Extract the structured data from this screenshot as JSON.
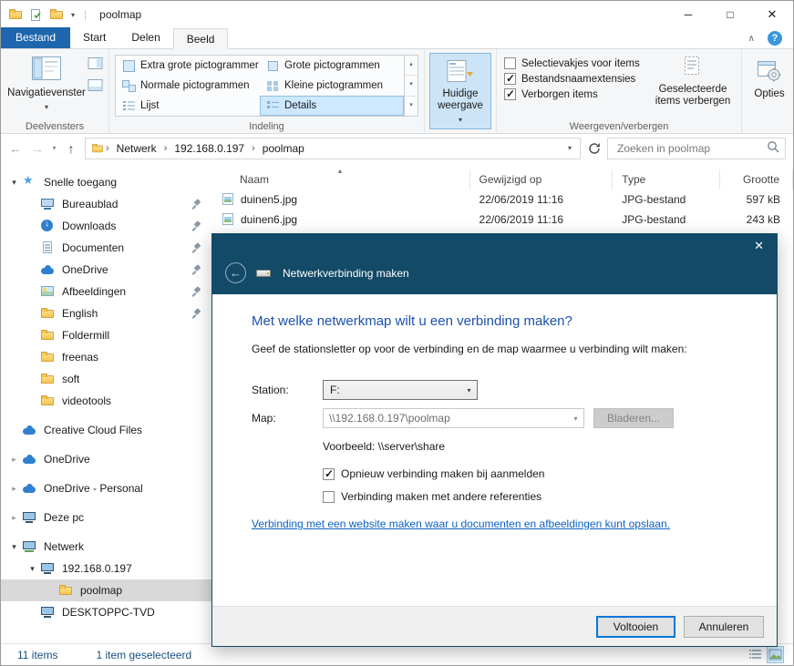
{
  "window": {
    "title": "poolmap"
  },
  "glyphs": {
    "minimize": "─",
    "maximize": "□",
    "close": "✕",
    "back": "←",
    "forward": "→",
    "up": "↑",
    "dropdown": "▾",
    "dropup": "▴",
    "crumb_separator": "›",
    "ribbon_collapse": "∧",
    "help": "?",
    "sort_ascending": "▴",
    "pipe": "|"
  },
  "icons": {
    "expand_open": "▾",
    "expand_closed": "▸",
    "checkbox_check": "✓",
    "quick_access_star": "★",
    "download_arrow": "↓"
  },
  "ribbon": {
    "tabs": [
      {
        "label": "Bestand",
        "style": "file"
      },
      {
        "label": "Start"
      },
      {
        "label": "Delen"
      },
      {
        "label": "Beeld",
        "active": true
      }
    ],
    "panes": {
      "group_label": "Deelvensters",
      "nav_button_label": "Navigatievenster"
    },
    "layout": {
      "group_label": "Indeling",
      "options": [
        {
          "label": "Extra grote pictogrammen"
        },
        {
          "label": "Grote pictogrammen"
        },
        {
          "label": "Normale pictogrammen"
        },
        {
          "label": "Kleine pictogrammen"
        },
        {
          "label": "Lijst"
        },
        {
          "label": "Details",
          "selected": true
        }
      ]
    },
    "current_view": {
      "button_label": "Huidige weergave"
    },
    "show_hide": {
      "group_label": "Weergeven/verbergen",
      "checkboxes": [
        {
          "label": "Selectievakjes voor items",
          "checked": false
        },
        {
          "label": "Bestandsnaamextensies",
          "checked": true
        },
        {
          "label": "Verborgen items",
          "checked": true
        }
      ],
      "hide_button_label": "Geselecteerde items verbergen"
    },
    "options": {
      "button_label": "Opties"
    }
  },
  "addressbar": {
    "breadcrumb": [
      "Netwerk",
      "192.168.0.197",
      "poolmap"
    ],
    "search_placeholder": "Zoeken in poolmap"
  },
  "sidebar": {
    "items": [
      {
        "label": "Snelle toegang",
        "icon": "star",
        "level": 0,
        "expander": "open",
        "pinned": false
      },
      {
        "label": "Bureaublad",
        "icon": "desktop",
        "level": 1,
        "pinned": true
      },
      {
        "label": "Downloads",
        "icon": "download",
        "level": 1,
        "pinned": true
      },
      {
        "label": "Documenten",
        "icon": "document",
        "level": 1,
        "pinned": true
      },
      {
        "label": "OneDrive",
        "icon": "cloud",
        "level": 1,
        "pinned": true
      },
      {
        "label": "Afbeeldingen",
        "icon": "picture",
        "level": 1,
        "pinned": true
      },
      {
        "label": "English",
        "icon": "folder",
        "level": 1,
        "pinned": true
      },
      {
        "label": "Foldermill",
        "icon": "folder",
        "level": 1,
        "pinned": false
      },
      {
        "label": "freenas",
        "icon": "folder",
        "level": 1,
        "pinned": false
      },
      {
        "label": "soft",
        "icon": "folder",
        "level": 1,
        "pinned": false
      },
      {
        "label": "videotools",
        "icon": "folder",
        "level": 1,
        "pinned": false
      },
      {
        "label": "Creative Cloud Files",
        "icon": "cloud",
        "level": 0,
        "pinned": false
      },
      {
        "label": "OneDrive",
        "icon": "cloud",
        "level": 0,
        "expander": "closed",
        "pinned": false
      },
      {
        "label": "OneDrive - Personal",
        "icon": "cloud",
        "level": 0,
        "expander": "closed",
        "pinned": false
      },
      {
        "label": "Deze pc",
        "icon": "pc",
        "level": 0,
        "expander": "closed",
        "pinned": false
      },
      {
        "label": "Netwerk",
        "icon": "network",
        "level": 0,
        "expander": "open",
        "pinned": false
      },
      {
        "label": "192.168.0.197",
        "icon": "pc",
        "level": 1,
        "expander": "open",
        "pinned": false
      },
      {
        "label": "poolmap",
        "icon": "folder",
        "level": 2,
        "selected": true,
        "pinned": false
      },
      {
        "label": "DESKTOPPC-TVD",
        "icon": "pc",
        "level": 1,
        "pinned": false
      }
    ]
  },
  "files": {
    "columns": [
      "Naam",
      "Gewijzigd op",
      "Type",
      "Grootte"
    ],
    "sort": {
      "column": "Naam",
      "direction": "ascending"
    },
    "rows": [
      {
        "name": "duinen5.jpg",
        "modified": "22/06/2019 11:16",
        "type": "JPG-bestand",
        "size": "597 kB"
      },
      {
        "name": "duinen6.jpg",
        "modified": "22/06/2019 11:16",
        "type": "JPG-bestand",
        "size": "243 kB"
      }
    ]
  },
  "dialog": {
    "title": "Netwerkverbinding maken",
    "heading": "Met welke netwerkmap wilt u een verbinding maken?",
    "instruction": "Geef de stationsletter op voor de verbinding en de map waarmee u verbinding wilt maken:",
    "station_label": "Station:",
    "station_value": "F:",
    "map_label": "Map:",
    "map_value": "\\\\192.168.0.197\\poolmap",
    "browse_button": "Bladeren...",
    "example": "Voorbeeld: \\\\server\\share",
    "checkboxes": [
      {
        "label": "Opnieuw verbinding maken bij aanmelden",
        "checked": true
      },
      {
        "label": "Verbinding maken met andere referenties",
        "checked": false
      }
    ],
    "link": "Verbinding met een website maken waar u documenten en afbeeldingen kunt opslaan.",
    "finish_button": "Voltooien",
    "cancel_button": "Annuleren"
  },
  "statusbar": {
    "total": "11 items",
    "selected": "1 item geselecteerd"
  },
  "colors": {
    "accent": "#0078d7",
    "file_tab": "#1e66ad",
    "dialog_header": "#124a68",
    "heading_blue": "#1d51ae",
    "link_blue": "#0b61c4",
    "gallery_selected": "#cde8ff",
    "sidebar_selected": "#d9d9d9"
  }
}
